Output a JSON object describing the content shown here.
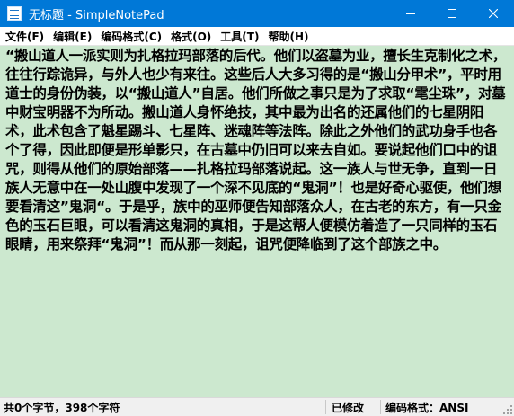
{
  "window": {
    "title": "无标题 - SimpleNotePad",
    "controls": {
      "minimize": "minimize",
      "maximize": "maximize",
      "close": "close"
    }
  },
  "menu": {
    "items": [
      {
        "label": "文件(F)"
      },
      {
        "label": "编辑(E)"
      },
      {
        "label": "编码格式(C)"
      },
      {
        "label": "格式(O)"
      },
      {
        "label": "工具(T)"
      },
      {
        "label": "帮助(H)"
      }
    ]
  },
  "editor": {
    "text": "“搬山道人一派实则为扎格拉玛部落的后代。他们以盗墓为业，擅长生克制化之术，往往行踪诡异，与外人也少有来往。这些后人大多习得的是“搬山分甲术”，平时用道士的身份伪装，以“搬山道人”自居。他们所做之事只是为了求取“雮尘珠”，对墓中财宝明器不为所动。搬山道人身怀绝技，其中最为出名的还属他们的七星阴阳术，此术包含了魁星踢斗、七星阵、迷魂阵等法阵。除此之外他们的武功身手也各个了得，因此即便是形单影只，在古墓中仍旧可以来去自如。要说起他们口中的诅咒，则得从他们的原始部落——扎格拉玛部落说起。这一族人与世无争，直到一日族人无意中在一处山腹中发现了一个深不见底的“鬼洞”！也是好奇心驱使，他们想要看清这”鬼洞“。于是乎，族中的巫师便告知部落众人，在古老的东方，有一只金色的玉石巨眼，可以看清这鬼洞的真相，于是这帮人便模仿着造了一只同样的玉石眼睛，用来祭拜“鬼洞”！而从那一刻起，诅咒便降临到了这个部族之中。",
    "background": "#cce8cf"
  },
  "status": {
    "counts": "共0个字节，398个字符",
    "modified": "已修改",
    "encoding": "编码格式：ANSI"
  },
  "colors": {
    "titlebar": "#0078d7",
    "editor_bg": "#cce8cf"
  }
}
